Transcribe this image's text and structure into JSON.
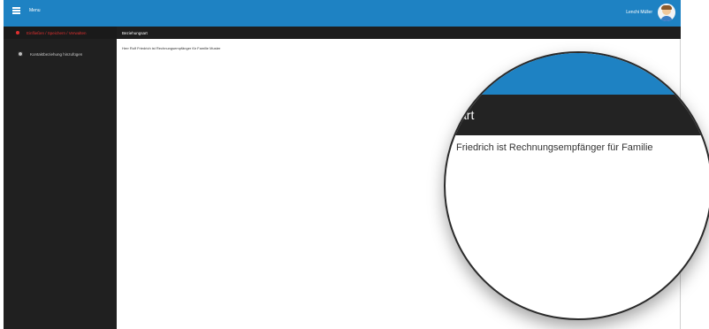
{
  "topbar": {
    "menu_label": "Menu",
    "user_name": "Lenchi Müller"
  },
  "sidebar": {
    "breadcrumb": "Einfließen / Speichern / Verwalten",
    "items": [
      {
        "label": "Kontaktbeziehung hinzufügen"
      }
    ]
  },
  "main": {
    "header_title": "Beziehungsart",
    "description": "Herr Rolf Friedrich ist Rechnungsempfänger für Familie Muster"
  },
  "lens": {
    "header_fragment": "art",
    "text_fragment": "Friedrich ist Rechnungsempfänger für Familie"
  },
  "colors": {
    "accent": "#1e82c3",
    "sidebar": "#202020",
    "crumb_text": "#e03030"
  }
}
